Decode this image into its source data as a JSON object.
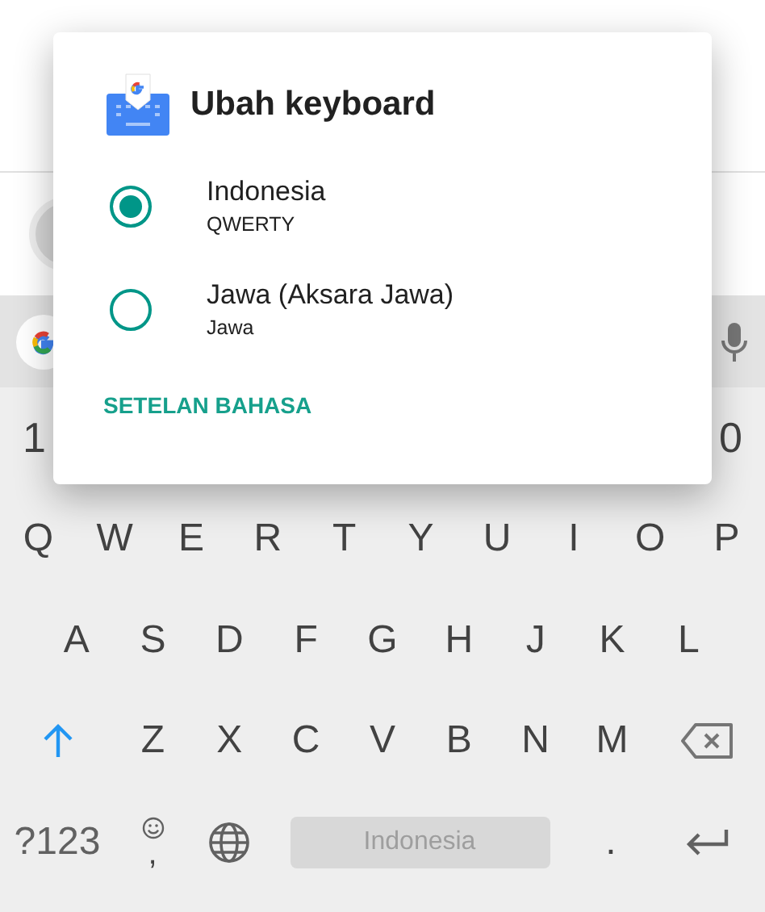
{
  "dialog": {
    "title": "Ubah keyboard",
    "options": [
      {
        "label": "Indonesia",
        "sublabel": "QWERTY",
        "selected": true
      },
      {
        "label": "Jawa (Aksara Jawa)",
        "sublabel": "Jawa",
        "selected": false
      }
    ],
    "action": "SETELAN BAHASA"
  },
  "keyboard": {
    "number_row": [
      "1",
      "0"
    ],
    "rows": [
      [
        "Q",
        "W",
        "E",
        "R",
        "T",
        "Y",
        "U",
        "I",
        "O",
        "P"
      ],
      [
        "A",
        "S",
        "D",
        "F",
        "G",
        "H",
        "J",
        "K",
        "L"
      ],
      [
        "Z",
        "X",
        "C",
        "V",
        "B",
        "N",
        "M"
      ]
    ],
    "symbols_key": "?123",
    "comma_key": ",",
    "space_key": "Indonesia",
    "period_key": "."
  }
}
